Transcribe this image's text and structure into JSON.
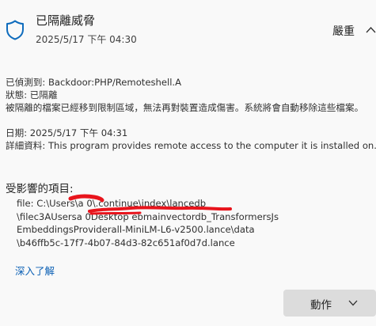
{
  "header": {
    "title": "已隔離威脅",
    "timestamp": "2025/5/17 下午 04:30",
    "severity": "嚴重",
    "icon": "shield-icon"
  },
  "details": {
    "detected": "已偵測到: Backdoor:PHP/Remoteshell.A",
    "status": "狀態: 已隔離",
    "description": "被隔離的檔案已經移到限制區域，無法再對裝置造成傷害。系統將會自動移除這些檔案。",
    "date": "日期: 2025/5/17 下午 04:31",
    "info": "詳細資料: This program provides remote access to the computer it is installed on."
  },
  "affected": {
    "heading": "受影響的項目:",
    "lines": [
      "file: C:\\Users\\a    0\\.continue\\index\\lancedb",
      "\\filec3AUsersa    0Desktop                    ebmainvectordb_TransformersJs",
      "EmbeddingsProviderall-MiniLM-L6-v2500.lance\\data",
      "\\b46ffb5c-17f7-4b07-84d3-82c651af0d7d.lance"
    ]
  },
  "learn_more": "深入了解",
  "action_button": {
    "label": "動作"
  },
  "colors": {
    "background": "#f9f9f9",
    "shield": "#0f6cbd",
    "link": "#0a5fb4",
    "button_bg": "#dcdcdc",
    "redaction": "#e8141c"
  }
}
